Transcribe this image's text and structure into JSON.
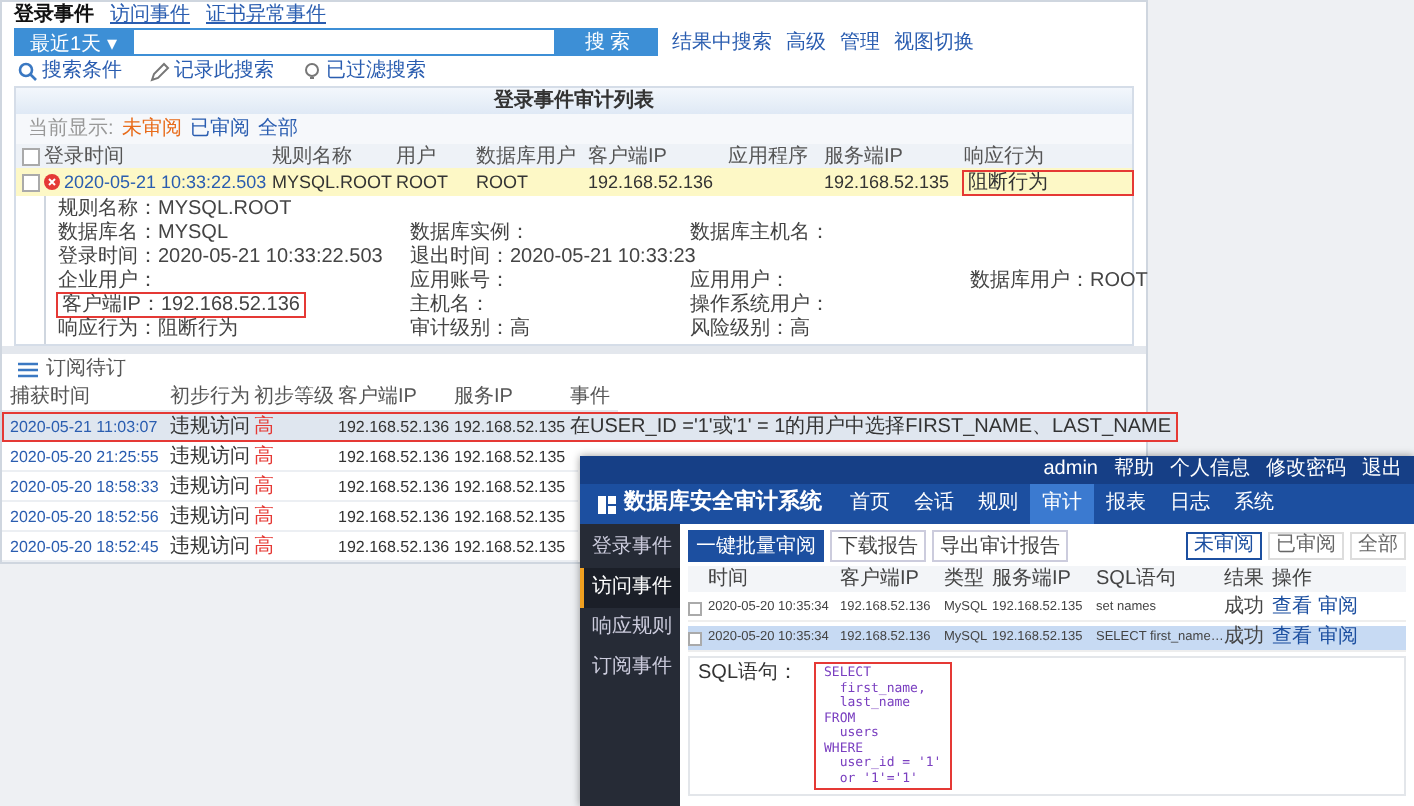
{
  "audit_console": {
    "event_tabs": [
      {
        "label": "登录事件",
        "selected": true
      },
      {
        "label": "访问事件",
        "selected": false
      },
      {
        "label": "证书异常事件",
        "selected": false
      }
    ],
    "search": {
      "range": "最近1天 ▾",
      "button": "搜 索",
      "links": [
        "结果中搜索",
        "高级",
        "管理",
        "视图切换"
      ]
    },
    "toolbar": [
      "搜索条件",
      "记录此搜索",
      "已过滤搜索"
    ],
    "login_list": {
      "title": "登录事件审计列表",
      "filter_label": "当前显示:",
      "filters": [
        {
          "label": "未审阅",
          "selected": true
        },
        {
          "label": "已审阅",
          "selected": false
        },
        {
          "label": "全部",
          "selected": false
        }
      ],
      "select_all_checked": false,
      "columns": [
        "登录时间",
        "规则名称",
        "用户",
        "数据库用户",
        "客户端IP",
        "应用程序",
        "服务端IP",
        "响应行为"
      ],
      "rows": [
        {
          "checked": false,
          "selected": true,
          "blocked": true,
          "time": "2020-05-21 10:33:22.503",
          "rule": "MYSQL.ROOT",
          "user": "ROOT",
          "db_user": "ROOT",
          "client_ip": "192.168.52.136",
          "server_ip": "192.168.52.135",
          "response": "阻断行为",
          "response_highlighted": true
        }
      ],
      "details": [
        [
          {
            "text": "规则名称：MYSQL.ROOT",
            "highlighted": false
          }
        ],
        [
          {
            "text": "数据库名：MYSQL",
            "highlighted": false
          },
          {
            "text": "数据库实例：",
            "highlighted": false
          },
          {
            "text": "数据库主机名：",
            "highlighted": false
          }
        ],
        [
          {
            "text": "登录时间：2020-05-21 10:33:22.503",
            "highlighted": false
          },
          {
            "text": "退出时间：2020-05-21 10:33:23",
            "highlighted": false
          }
        ],
        [
          {
            "text": "企业用户：",
            "highlighted": false
          },
          {
            "text": "应用账号：",
            "highlighted": false
          },
          {
            "text": "应用用户：",
            "highlighted": false
          },
          {
            "text": "数据库用户：ROOT",
            "highlighted": false
          }
        ],
        [
          {
            "text": "客户端IP：192.168.52.136",
            "highlighted": true
          },
          {
            "text": "主机名：",
            "highlighted": false
          },
          {
            "text": "操作系统用户：",
            "highlighted": false
          }
        ],
        [
          {
            "text": "响应行为：阻断行为",
            "highlighted": false
          },
          {
            "text": "审计级别：高",
            "highlighted": false
          },
          {
            "text": "风险级别：高",
            "highlighted": false
          }
        ]
      ]
    },
    "subscription": {
      "title": "订阅待订",
      "columns": [
        "捕获时间",
        "初步行为",
        "初步等级",
        "客户端IP",
        "服务IP",
        "事件"
      ],
      "rows": [
        {
          "selected": true,
          "highlighted": true,
          "time": "2020-05-21 11:03:07",
          "behavior": "违规访问",
          "level": "高",
          "client_ip": "192.168.52.136",
          "server_ip": "192.168.52.135",
          "event": "在USER_ID ='1'或'1' = 1的用户中选择FIRST_NAME、LAST_NAME"
        },
        {
          "selected": false,
          "highlighted": false,
          "time": "2020-05-20 21:25:55",
          "behavior": "违规访问",
          "level": "高",
          "client_ip": "192.168.52.136",
          "server_ip": "192.168.52.135"
        },
        {
          "selected": false,
          "highlighted": false,
          "time": "2020-05-20 18:58:33",
          "behavior": "违规访问",
          "level": "高",
          "client_ip": "192.168.52.136",
          "server_ip": "192.168.52.135"
        },
        {
          "selected": false,
          "highlighted": false,
          "time": "2020-05-20 18:52:56",
          "behavior": "违规访问",
          "level": "高",
          "client_ip": "192.168.52.136",
          "server_ip": "192.168.52.135"
        },
        {
          "selected": false,
          "highlighted": false,
          "time": "2020-05-20 18:52:45",
          "behavior": "违规访问",
          "level": "高",
          "client_ip": "192.168.52.136",
          "server_ip": "192.168.52.135"
        }
      ]
    }
  },
  "security_audit_system": {
    "user_menu": [
      "admin",
      "帮助",
      "个人信息",
      "修改密码",
      "退出"
    ],
    "logo": "数据库安全审计系统",
    "nav": [
      {
        "label": "首页",
        "selected": false
      },
      {
        "label": "会话",
        "selected": false
      },
      {
        "label": "规则",
        "selected": false
      },
      {
        "label": "审计",
        "selected": true
      },
      {
        "label": "报表",
        "selected": false
      },
      {
        "label": "日志",
        "selected": false
      },
      {
        "label": "系统",
        "selected": false
      }
    ],
    "sidebar": [
      {
        "label": "登录事件",
        "selected": false
      },
      {
        "label": "访问事件",
        "selected": true
      },
      {
        "label": "响应规则",
        "selected": false
      },
      {
        "label": "订阅事件",
        "selected": false
      }
    ],
    "buttons": [
      "一键批量审阅",
      "下载报告",
      "导出审计报告"
    ],
    "filters": [
      {
        "label": "未审阅",
        "selected": true
      },
      {
        "label": "已审阅",
        "selected": false
      },
      {
        "label": "全部",
        "selected": false
      }
    ],
    "columns": [
      "时间",
      "客户端IP",
      "类型",
      "服务端IP",
      "SQL语句",
      "结果",
      "操作"
    ],
    "rows": [
      {
        "selected": false,
        "time": "2020-05-20 10:35:34",
        "client_ip": "192.168.52.136",
        "db_type": "MySQL",
        "server_ip": "192.168.52.135",
        "sql": "set names",
        "result": "成功",
        "action": "查看 审阅"
      },
      {
        "selected": true,
        "time": "2020-05-20 10:35:34",
        "client_ip": "192.168.52.136",
        "db_type": "MySQL",
        "server_ip": "192.168.52.135",
        "sql": "SELECT first_name…",
        "result": "成功",
        "action": "查看 审阅"
      }
    ],
    "detail_label": "SQL语句：",
    "code": [
      "SELECT",
      "  first_name,",
      "  last_name",
      "FROM",
      "  users",
      "WHERE",
      "  user_id = '1'",
      "  or '1'='1'"
    ],
    "code_highlighted": true
  }
}
